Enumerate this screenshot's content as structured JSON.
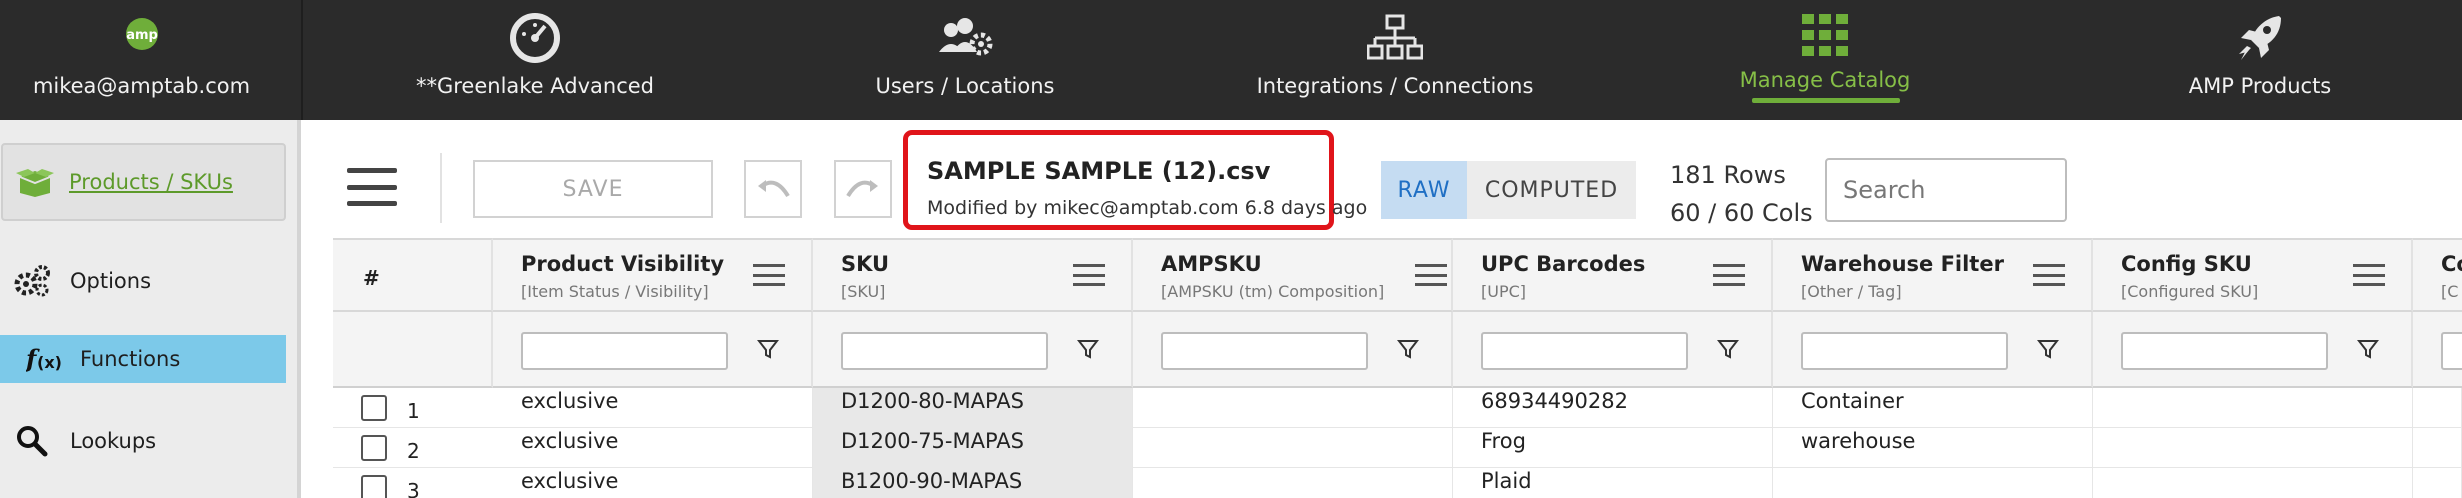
{
  "topnav": {
    "user": "mikea@amptab.com",
    "items": [
      {
        "label": "**Greenlake Advanced",
        "icon": "dashboard-gauge-icon"
      },
      {
        "label": "Users / Locations",
        "icon": "users-gear-icon"
      },
      {
        "label": "Integrations / Connections",
        "icon": "network-sitemap-icon"
      },
      {
        "label": "Manage Catalog",
        "icon": "grid-apps-icon",
        "active": true
      },
      {
        "label": "AMP Products",
        "icon": "rocket-icon"
      }
    ]
  },
  "sidebar": {
    "items": [
      {
        "label": "Products / SKUs",
        "icon": "box-open-icon",
        "active": true
      },
      {
        "label": "Options",
        "icon": "gears-icon"
      },
      {
        "label": "Functions",
        "icon": "function-fx-icon",
        "selected": true
      },
      {
        "label": "Lookups",
        "icon": "magnifier-icon"
      }
    ]
  },
  "toolbar": {
    "save_label": "SAVE",
    "file_name": "SAMPLE SAMPLE (12).csv",
    "file_meta": "Modified by mikec@amptab.com 6.8 days ago",
    "mode_raw": "RAW",
    "mode_computed": "COMPUTED",
    "rows": "181 Rows",
    "cols": "60 / 60 Cols",
    "search_placeholder": "Search"
  },
  "grid": {
    "hash_label": "#",
    "columns": [
      {
        "title": "Product Visibility",
        "sub": "[Item Status / Visibility]"
      },
      {
        "title": "SKU",
        "sub": "[SKU]"
      },
      {
        "title": "AMPSKU",
        "sub": "[AMPSKU (tm) Composition]"
      },
      {
        "title": "UPC Barcodes",
        "sub": "[UPC]"
      },
      {
        "title": "Warehouse Filter",
        "sub": "[Other / Tag]"
      },
      {
        "title": "Config SKU",
        "sub": "[Configured SKU]"
      },
      {
        "title": "Co",
        "sub": "[C"
      }
    ],
    "rows": [
      {
        "num": "1",
        "cells": [
          "exclusive",
          "D1200-80-MAPAS",
          "",
          "68934490282",
          "Container",
          "",
          ""
        ]
      },
      {
        "num": "2",
        "cells": [
          "exclusive",
          "D1200-75-MAPAS",
          "",
          "Frog",
          "warehouse",
          "",
          ""
        ]
      },
      {
        "num": "3",
        "cells": [
          "exclusive",
          "B1200-90-MAPAS",
          "",
          "Plaid",
          "",
          "",
          ""
        ]
      }
    ]
  },
  "colors": {
    "nav_bg": "#2b2b2b",
    "active_green": "#86bf47",
    "functions_blue": "#7cc9e9",
    "highlight_red": "#e0141a",
    "raw_blue": "#1f6fc4"
  }
}
